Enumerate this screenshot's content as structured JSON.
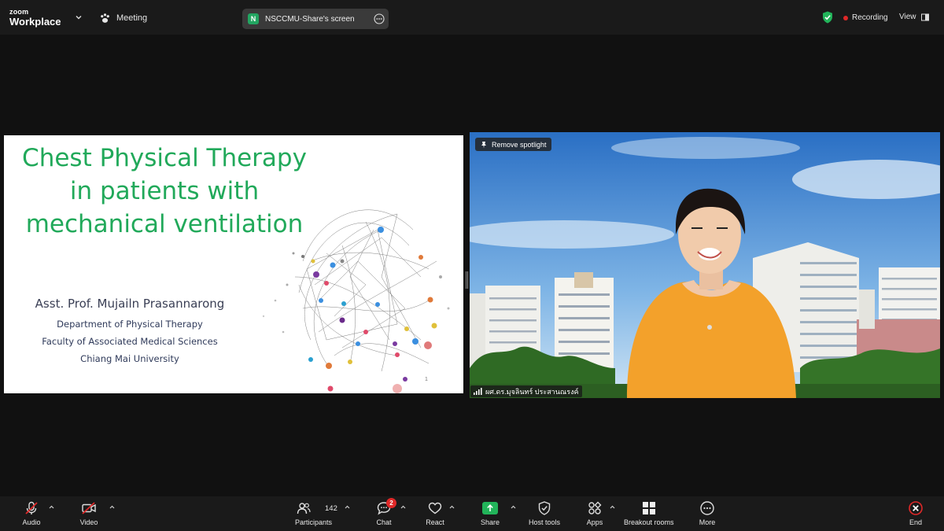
{
  "app": {
    "logo_line1": "zoom",
    "logo_line2": "Workplace",
    "meeting_label": "Meeting"
  },
  "share_pill": {
    "badge": "N",
    "text": "NSCCMU-Share's screen"
  },
  "status": {
    "recording_label": "Recording",
    "view_label": "View",
    "recording_color": "#e02828",
    "shield_color": "#22b45a"
  },
  "slide": {
    "title_lines": [
      "Chest Physical Therapy",
      "in patients with",
      "mechanical ventilation"
    ],
    "author": "Asst. Prof. Mujailn Prasannarong",
    "affiliations": [
      "Department of Physical Therapy",
      "Faculty of Associated Medical Sciences",
      "Chiang Mai University"
    ],
    "page_number": "1",
    "title_color": "#21a95a"
  },
  "video": {
    "remove_spotlight_label": "Remove spotlight",
    "participant_name": "ผศ.ดร.มุจลินทร์ ประสานณรงค์"
  },
  "toolbar": {
    "audio_label": "Audio",
    "video_label": "Video",
    "participants_label": "Participants",
    "participants_count": "142",
    "chat_label": "Chat",
    "chat_badge": "2",
    "react_label": "React",
    "share_label": "Share",
    "host_tools_label": "Host tools",
    "apps_label": "Apps",
    "breakout_label": "Breakout rooms",
    "more_label": "More",
    "end_label": "End"
  },
  "icons": {
    "muted_mic": "mic-off-icon",
    "video_off": "video-off-icon",
    "participants": "people-icon",
    "chat": "chat-bubble-icon",
    "react": "heart-icon",
    "share": "share-arrow-icon",
    "host_tools": "shield-icon",
    "apps": "apps-icon",
    "breakout": "grid-icon",
    "more": "ellipsis-icon",
    "end": "close-circle-icon"
  }
}
